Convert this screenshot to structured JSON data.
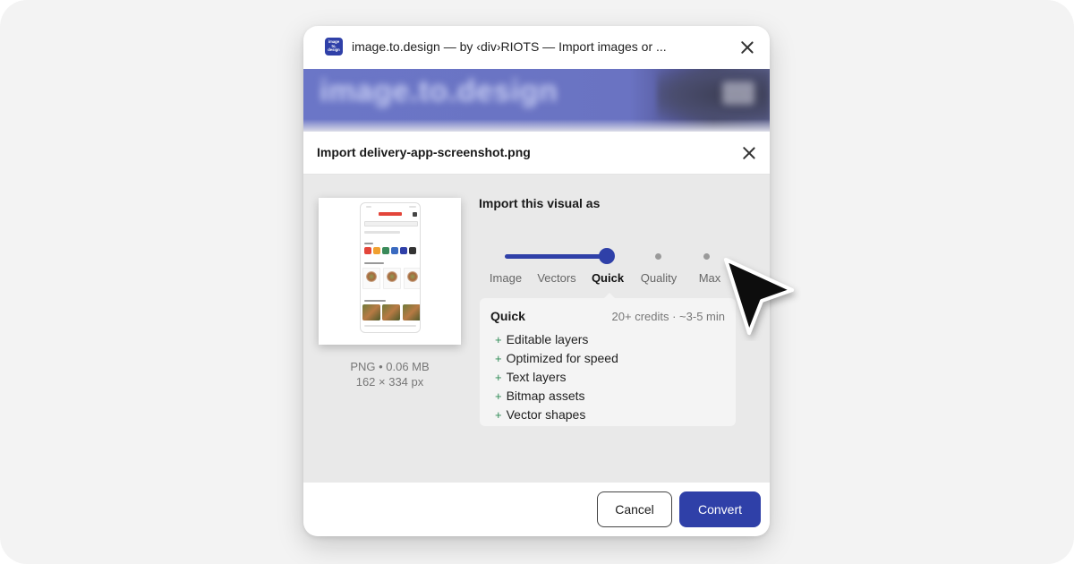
{
  "titlebar": {
    "logo_lines": [
      "image",
      "to.",
      "design"
    ],
    "title": "image.to.design — by ‹div›RIOTS — Import images or ..."
  },
  "banner": {
    "text": "image.to.design"
  },
  "dialog": {
    "title": "Import delivery-app-screenshot.png",
    "file": {
      "format_size": "PNG • 0.06 MB",
      "dimensions": "162 × 334 px"
    },
    "import_section": {
      "title": "Import this visual as",
      "options": [
        "Image",
        "Vectors",
        "Quick",
        "Quality",
        "Max"
      ],
      "selected": "Quick",
      "selected_index": 2
    },
    "info": {
      "name": "Quick",
      "cost": "20+ credits · ~3-5 min",
      "features": [
        "Editable layers",
        "Optimized for speed",
        "Text layers",
        "Bitmap assets",
        "Vector shapes"
      ]
    },
    "buttons": {
      "cancel": "Cancel",
      "convert": "Convert"
    }
  },
  "colors": {
    "accent": "#2f40a8",
    "feature_plus": "#2e8a55",
    "background": "#f3f3f3"
  },
  "icons": {
    "window_close": "close-icon",
    "dialog_close": "close-icon",
    "pointer": "cursor-arrow-icon"
  }
}
